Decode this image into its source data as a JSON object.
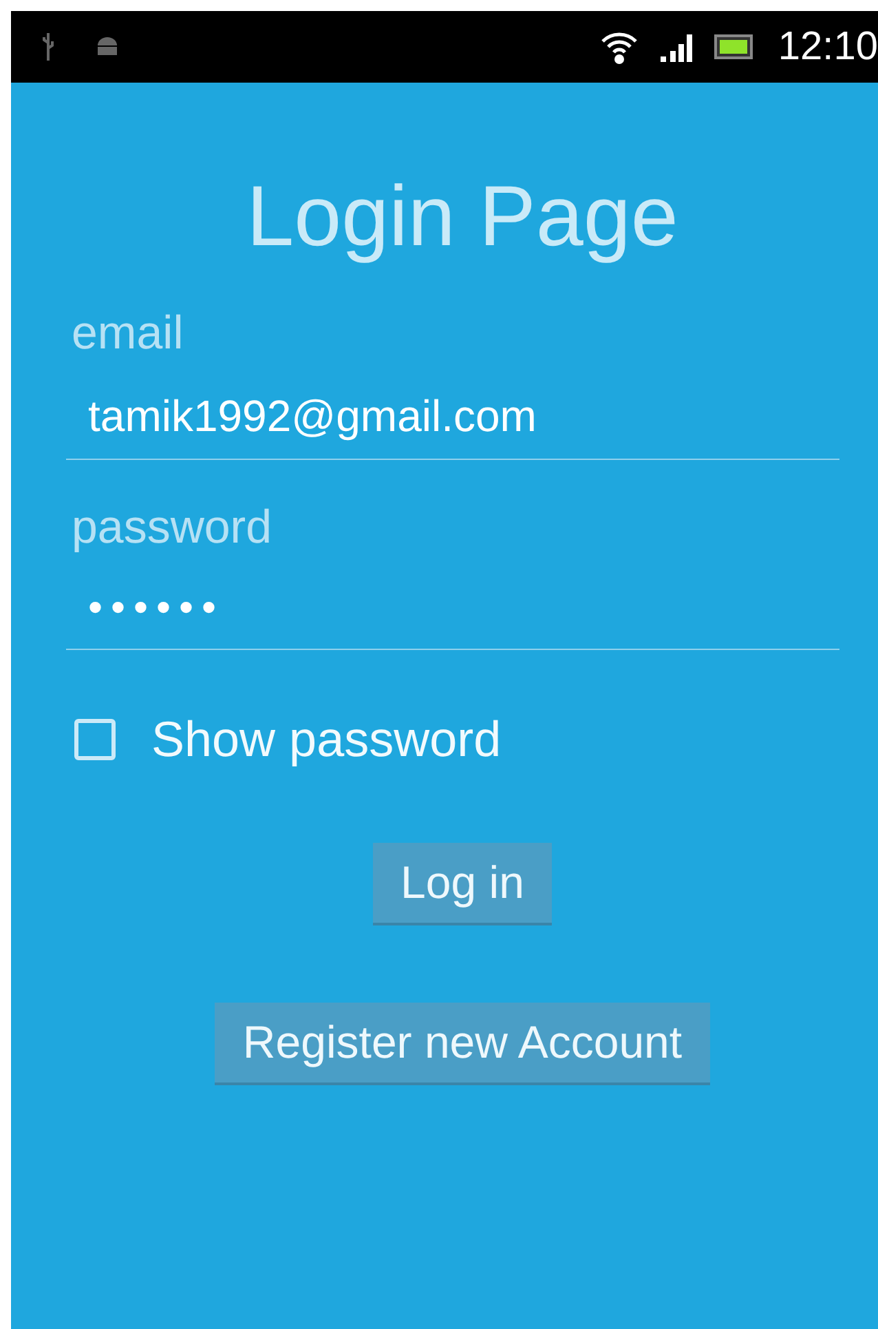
{
  "status_bar": {
    "time": "12:10"
  },
  "title": "Login Page",
  "fields": [
    {
      "label": "email",
      "value": "tamik1992@gmail.com",
      "kind": "text"
    },
    {
      "label": "password",
      "value": "••••••",
      "kind": "password"
    }
  ],
  "show_password": {
    "label": "Show password",
    "checked": false
  },
  "buttons": [
    "Log in",
    "Register new Account"
  ]
}
